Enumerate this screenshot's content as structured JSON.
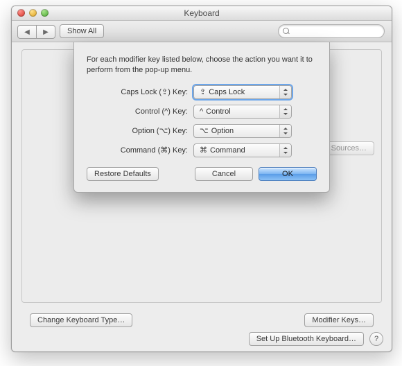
{
  "window": {
    "title": "Keyboard"
  },
  "toolbar": {
    "show_all": "Show All",
    "back_icon": "◀",
    "forward_icon": "▶",
    "search_placeholder": ""
  },
  "panel": {
    "input_sources_btn": "Input Sources…",
    "change_keyboard_type": "Change Keyboard Type…",
    "modifier_keys": "Modifier Keys…",
    "setup_bluetooth": "Set Up Bluetooth Keyboard…",
    "help": "?"
  },
  "sheet": {
    "description": "For each modifier key listed below, choose the action you want it to perform from the pop-up menu.",
    "rows": [
      {
        "label": "Caps Lock (⇪) Key:",
        "symbol": "⇪",
        "value": "Caps Lock",
        "focused": true
      },
      {
        "label": "Control (^) Key:",
        "symbol": "^",
        "value": "Control"
      },
      {
        "label": "Option (⌥) Key:",
        "symbol": "⌥",
        "value": "Option"
      },
      {
        "label": "Command (⌘) Key:",
        "symbol": "⌘",
        "value": "Command"
      }
    ],
    "restore_defaults": "Restore Defaults",
    "cancel": "Cancel",
    "ok": "OK"
  }
}
